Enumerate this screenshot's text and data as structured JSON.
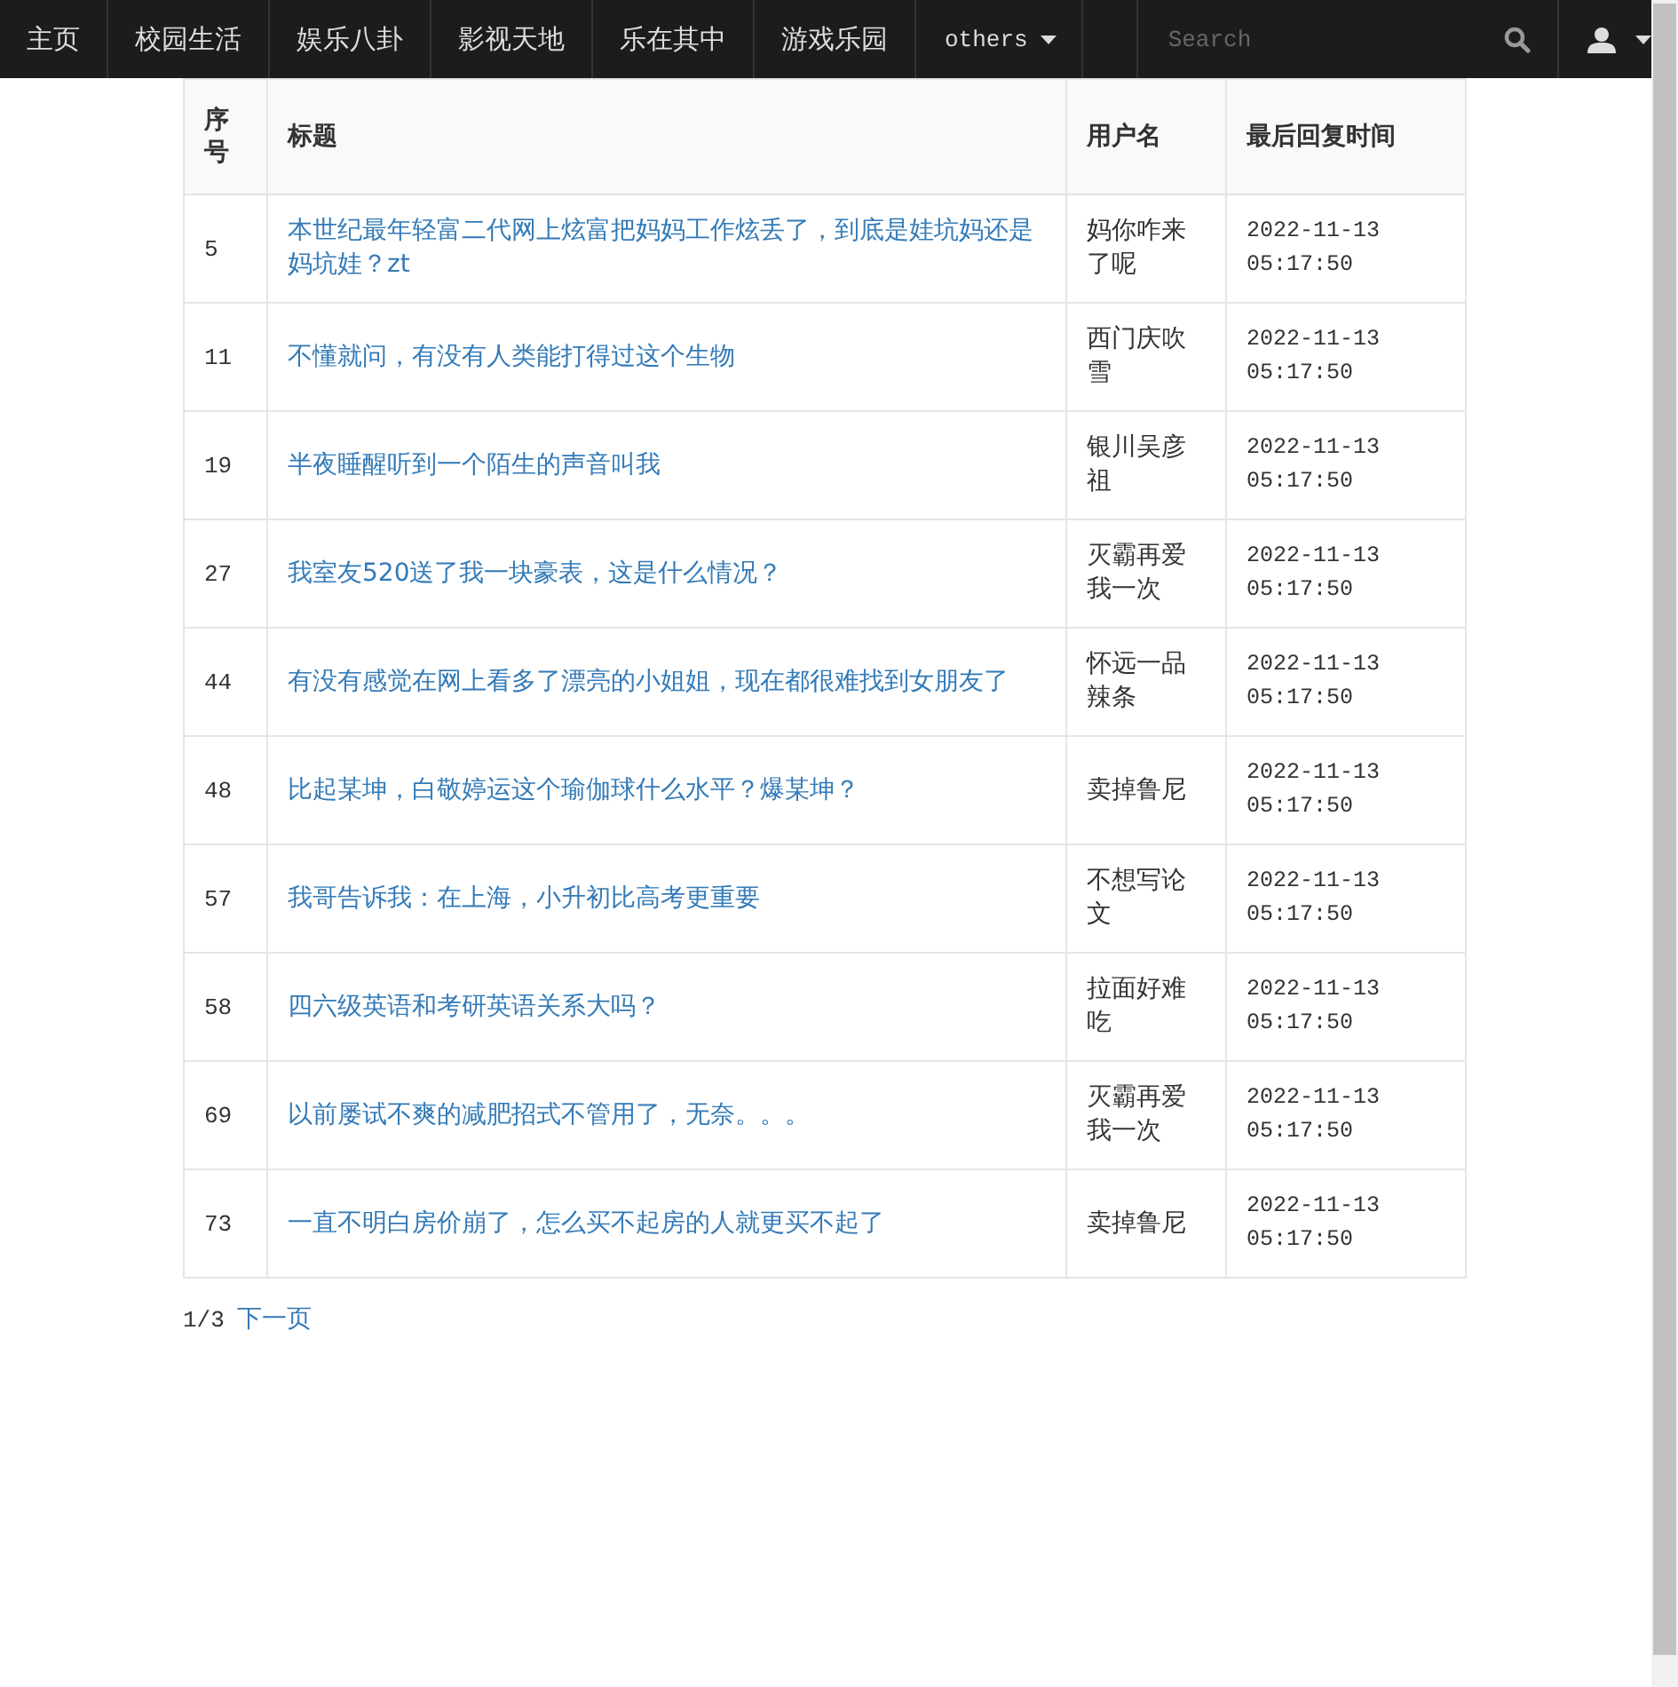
{
  "navbar": {
    "items": [
      {
        "label": "主页"
      },
      {
        "label": "校园生活"
      },
      {
        "label": "娱乐八卦"
      },
      {
        "label": "影视天地"
      },
      {
        "label": "乐在其中"
      },
      {
        "label": "游戏乐园"
      },
      {
        "label": "others",
        "kind": "dropdown"
      }
    ],
    "search": {
      "placeholder": "Search"
    }
  },
  "table": {
    "columns": [
      "序号",
      "标题",
      "用户名",
      "最后回复时间"
    ],
    "rows": [
      {
        "id": "5",
        "title": "本世纪最年轻富二代网上炫富把妈妈工作炫丢了，到底是娃坑妈还是妈坑娃？zt",
        "user": "妈你咋来了呢",
        "time": "2022-11-13 05:17:50"
      },
      {
        "id": "11",
        "title": "不懂就问，有没有人类能打得过这个生物",
        "user": "西门庆吹雪",
        "time": "2022-11-13 05:17:50"
      },
      {
        "id": "19",
        "title": "半夜睡醒听到一个陌生的声音叫我",
        "user": "银川吴彦祖",
        "time": "2022-11-13 05:17:50"
      },
      {
        "id": "27",
        "title": "我室友520送了我一块豪表，这是什么情况？",
        "user": "灭霸再爱我一次",
        "time": "2022-11-13 05:17:50"
      },
      {
        "id": "44",
        "title": "有没有感觉在网上看多了漂亮的小姐姐，现在都很难找到女朋友了",
        "user": "怀远一品辣条",
        "time": "2022-11-13 05:17:50"
      },
      {
        "id": "48",
        "title": "比起某坤，白敬婷运这个瑜伽球什么水平？爆某坤？",
        "user": "卖掉鲁尼",
        "time": "2022-11-13 05:17:50"
      },
      {
        "id": "57",
        "title": "我哥告诉我：在上海，小升初比高考更重要",
        "user": "不想写论文",
        "time": "2022-11-13 05:17:50"
      },
      {
        "id": "58",
        "title": "四六级英语和考研英语关系大吗？",
        "user": "拉面好难吃",
        "time": "2022-11-13 05:17:50"
      },
      {
        "id": "69",
        "title": "以前屡试不爽的减肥招式不管用了，无奈。。。",
        "user": "灭霸再爱我一次",
        "time": "2022-11-13 05:17:50"
      },
      {
        "id": "73",
        "title": "一直不明白房价崩了，怎么买不起房的人就更买不起了",
        "user": "卖掉鲁尼",
        "time": "2022-11-13 05:17:50"
      }
    ]
  },
  "pagination": {
    "page": "1/3",
    "next": "下一页"
  }
}
